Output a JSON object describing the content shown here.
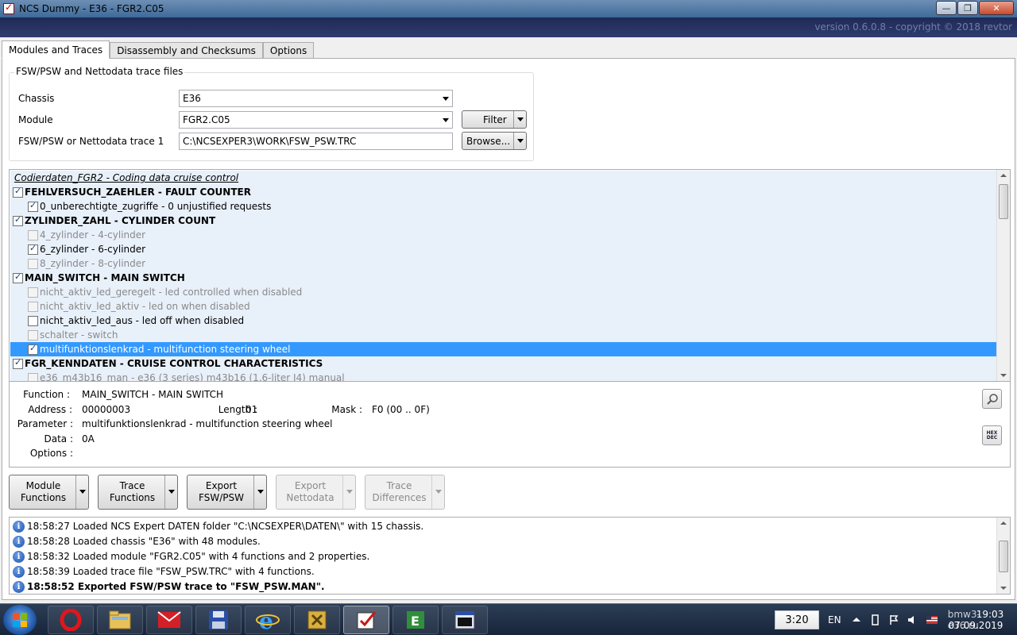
{
  "window": {
    "title": "NCS Dummy - E36 - FGR2.C05",
    "minimize": "—",
    "maximize": "❐",
    "close": "✕",
    "version": "version 0.6.0.8 - copyright © 2018 revtor"
  },
  "tabs": [
    {
      "label": "Modules and Traces",
      "active": true
    },
    {
      "label": "Disassembly and Checksums",
      "active": false
    },
    {
      "label": "Options",
      "active": false
    }
  ],
  "files": {
    "legend": "FSW/PSW and Nettodata trace files",
    "chassis_label": "Chassis",
    "chassis_value": "E36",
    "module_label": "Module",
    "module_value": "FGR2.C05",
    "trace_label": "FSW/PSW or Nettodata trace 1",
    "trace_value": "C:\\NCSEXPER3\\WORK\\FSW_PSW.TRC",
    "filter_label": "Filter",
    "browse_label": "Browse..."
  },
  "tree": {
    "header": "Codierdaten_FGR2  -  Coding data cruise control",
    "rows": [
      {
        "kind": "func",
        "text": "FEHLVERSUCH_ZAEHLER  -  FAULT COUNTER",
        "checked": true,
        "disabled": false,
        "selected": false
      },
      {
        "kind": "param",
        "text": "0_unberechtigte_zugriffe  -  0 unjustified requests",
        "checked": true,
        "disabled": false,
        "selected": false
      },
      {
        "kind": "func",
        "text": "ZYLINDER_ZAHL  -  CYLINDER COUNT",
        "checked": true,
        "disabled": false,
        "selected": false
      },
      {
        "kind": "param",
        "text": "4_zylinder  -  4-cylinder",
        "checked": false,
        "disabled": true,
        "selected": false
      },
      {
        "kind": "param",
        "text": "6_zylinder  -  6-cylinder",
        "checked": true,
        "disabled": false,
        "selected": false
      },
      {
        "kind": "param",
        "text": "8_zylinder  -  8-cylinder",
        "checked": false,
        "disabled": true,
        "selected": false
      },
      {
        "kind": "func",
        "text": "MAIN_SWITCH  -  MAIN SWITCH",
        "checked": true,
        "disabled": false,
        "selected": false
      },
      {
        "kind": "param",
        "text": "nicht_aktiv_led_geregelt  -  led controlled when disabled",
        "checked": false,
        "disabled": true,
        "selected": false
      },
      {
        "kind": "param",
        "text": "nicht_aktiv_led_aktiv  -  led on when disabled",
        "checked": false,
        "disabled": true,
        "selected": false
      },
      {
        "kind": "param",
        "text": "nicht_aktiv_led_aus  -  led off when disabled",
        "checked": false,
        "disabled": false,
        "selected": false
      },
      {
        "kind": "param",
        "text": "schalter  -  switch",
        "checked": false,
        "disabled": true,
        "selected": false
      },
      {
        "kind": "param",
        "text": "multifunktionslenkrad  -  multifunction steering wheel",
        "checked": true,
        "disabled": false,
        "selected": true
      },
      {
        "kind": "func",
        "text": "FGR_KENNDATEN  -  CRUISE CONTROL CHARACTERISTICS",
        "checked": true,
        "disabled": false,
        "selected": false
      },
      {
        "kind": "param",
        "text": "e36_m43b16_man  -  e36 (3 series) m43b16 (1.6-liter I4) manual",
        "checked": false,
        "disabled": true,
        "selected": false
      }
    ]
  },
  "details": {
    "function_label": "Function :",
    "function_value": "MAIN_SWITCH  -  MAIN SWITCH",
    "address_label": "Address :",
    "address_value": "00000003",
    "length_label": "Length :",
    "length_value": "01",
    "mask_label": "Mask :",
    "mask_value": "F0  (00 .. 0F)",
    "parameter_label": "Parameter :",
    "parameter_value": "multifunktionslenkrad  -  multifunction steering wheel",
    "data_label": "Data :",
    "data_value": "0A",
    "options_label": "Options :",
    "hexdec_top": "HEX",
    "hexdec_bottom": "DEC"
  },
  "actions": [
    {
      "line1": "Module",
      "line2": "Functions",
      "enabled": true
    },
    {
      "line1": "Trace",
      "line2": "Functions",
      "enabled": true
    },
    {
      "line1": "Export",
      "line2": "FSW/PSW",
      "enabled": true
    },
    {
      "line1": "Export",
      "line2": "Nettodata",
      "enabled": false
    },
    {
      "line1": "Trace",
      "line2": "Differences",
      "enabled": false
    }
  ],
  "log": [
    {
      "text": "18:58:27  Loaded NCS Expert DATEN folder \"C:\\NCSEXPER\\DATEN\\\" with 15 chassis.",
      "bold": false
    },
    {
      "text": "18:58:28  Loaded chassis \"E36\" with 48 modules.",
      "bold": false
    },
    {
      "text": "18:58:32  Loaded module \"FGR2.C05\" with 4 functions and 2 properties.",
      "bold": false
    },
    {
      "text": "18:58:39  Loaded trace file \"FSW_PSW.TRC\" with 4 functions.",
      "bold": false
    },
    {
      "text": "18:58:52  Exported FSW/PSW trace to \"FSW_PSW.MAN\".",
      "bold": true
    }
  ],
  "taskbar": {
    "clock_box": "3:20",
    "lang": "EN",
    "watermark": "bmw3-e36.ru",
    "time": "19:03",
    "date": "07.09.2019"
  }
}
